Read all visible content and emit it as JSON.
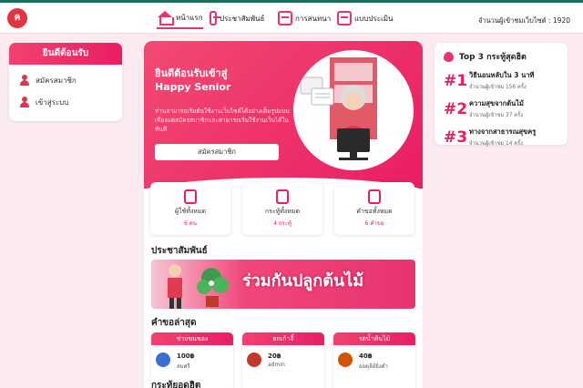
{
  "nav": {
    "logo": "ค",
    "items": [
      {
        "label": "หน้าแรก",
        "icon": "home-icon"
      },
      {
        "label": "ประชาสัมพันธ์",
        "icon": "megaphone-icon"
      },
      {
        "label": "การสนทนา",
        "icon": "chat-icon"
      },
      {
        "label": "แบบประเมิน",
        "icon": "clipboard-icon"
      }
    ],
    "visitors": "จำนวนผู้เข้าชมเว็บไซต์ : 1920"
  },
  "welcome": {
    "title": "ยินดีต้อนรับ",
    "items": [
      "สมัครสมาชิก",
      "เข้าสู่ระบบ"
    ]
  },
  "hero": {
    "title_line1": "ยินดีต้อนรับเข้าสู่",
    "title_line2": "Happy Senior",
    "description": "ท่านสามารถเริ่มต้นใช้งานเว็บไซต์ได้อย่างเต็มรูปแบบเพียงแค่สมัครสมาชิกและสามารถเริ่มใช้งานเว็บได้ในทันที",
    "button": "สมัครสมาชิก"
  },
  "stats": [
    {
      "label": "ผู้ใช้ทั้งหมด",
      "value": "6 คน"
    },
    {
      "label": "กระทู้ทั้งหมด",
      "value": "4 กระทู้"
    },
    {
      "label": "คำขอทั้งหมด",
      "value": "6 คำขอ"
    }
  ],
  "pr": {
    "title": "ประชาสัมพันธ์",
    "banner_text": "ร่วมกันปลูกต้นไม้"
  },
  "requests": {
    "title": "คำขอล่าสุด",
    "items": [
      {
        "title": "ช่วยขนของ",
        "amount": "100฿",
        "name": "สมศรี",
        "avatar_color": "#3b6fd1"
      },
      {
        "title": "ยกเก้าอี้",
        "amount": "20฿",
        "name": "admin",
        "avatar_color": "#c0392b"
      },
      {
        "title": "รดน้ำต้นไม้",
        "amount": "40฿",
        "name": "ยอดุลีย์ยิงดำ",
        "avatar_color": "#d35400"
      }
    ]
  },
  "next_section": "กระทู้ยอดฮิต",
  "top3": {
    "title": "Top 3 กระทู้สุดฮิต",
    "items": [
      {
        "rank": "#1",
        "title": "วิธีนอนหลับใน 3 นาที",
        "views": "จำนวนผู้เข้าชม 156 ครั้ง"
      },
      {
        "rank": "#2",
        "title": "ความสุขจากต้นไม้",
        "views": "จำนวนผู้เข้าชม 37 ครั้ง"
      },
      {
        "rank": "#3",
        "title": "ทางจากสาธารณสุขครู",
        "views": "จำนวนผู้เข้าชม 14 ครั้ง"
      }
    ]
  },
  "colors": {
    "accent": "#e91e63",
    "topbar": "#1f6b5c",
    "background": "#fbeaf0"
  }
}
